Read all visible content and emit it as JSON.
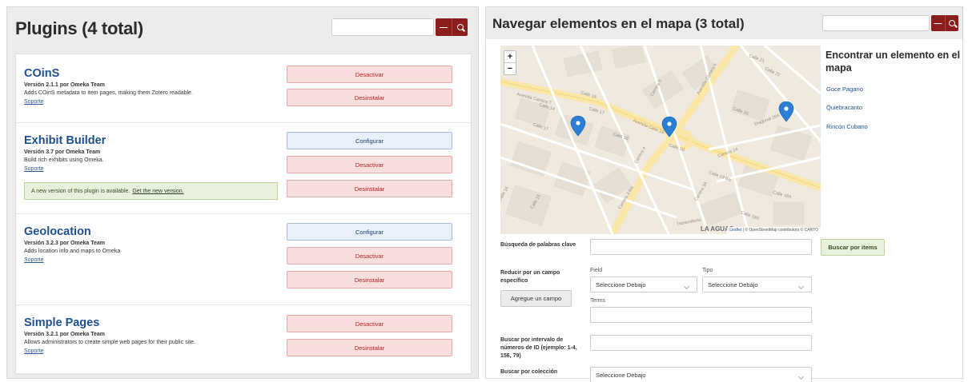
{
  "left": {
    "title": "Plugins (4 total)",
    "search_minus": "—",
    "plugins": [
      {
        "name": "COinS",
        "version": "Versión 2.1.1 por Omeka Team",
        "description": "Adds COinS metadata to item pages, making them Zotero readable.",
        "support": "Soporte",
        "buttons": [
          "Desactivar",
          "Desinstalar"
        ]
      },
      {
        "name": "Exhibit Builder",
        "version": "Versión 3.7 por Omeka Team",
        "description": "Build rich exhibits using Omeka.",
        "support": "Soporte",
        "buttons": [
          "Configurar",
          "Desactivar",
          "Desinstalar"
        ],
        "notice": "A new version of this plugin is available.",
        "notice_link": "Get the new version."
      },
      {
        "name": "Geolocation",
        "version": "Versión 3.2.3 por Omeka Team",
        "description": "Adds location info and maps to Omeka",
        "support": "Soporte",
        "buttons": [
          "Configurar",
          "Desactivar",
          "Desinstalar"
        ]
      },
      {
        "name": "Simple Pages",
        "version": "Versión 3.2.1 por Omeka Team",
        "description": "Allows administrators to create simple web pages for their public site.",
        "support": "Soporte",
        "buttons": [
          "Desactivar",
          "Desinstalar"
        ]
      }
    ]
  },
  "right": {
    "title": "Navegar elementos en el mapa (3 total)",
    "search_minus": "—",
    "map": {
      "zoom_in": "+",
      "zoom_out": "−",
      "attribution_leaflet": "Leaflet",
      "attribution_rest": "| © OpenStreetMap contributors © CARTO",
      "street_labels": [
        "Avenida Carrera 7",
        "Avenida Calle 19",
        "Carrera 4",
        "Carrera 5",
        "Calle 20",
        "Calle 21",
        "Calle 22",
        "Calle 18",
        "Calle 17",
        "Calle 16",
        "Calle 14",
        "Diagonal 20A",
        "Carrera 2A",
        "Calle 19 Bis",
        "Carrera 3A",
        "Carrera 3 Bis",
        "Calle 18A",
        "Calle 15",
        "LA AGUAS",
        "Transmilenio"
      ]
    },
    "find": {
      "title": "Encontrar un elemento en el mapa",
      "items": [
        "Goce Pagano",
        "Quiebracanto",
        "Rincón Cubano"
      ]
    },
    "form": {
      "keyword_label": "Búsqueda de palabras clave",
      "search_button": "Buscar por items",
      "narrow_label": "Reducir por un campo específico",
      "field_label": "Field",
      "type_label": "Tipo",
      "field_select": "Seleccione Debajo",
      "type_select": "Seleccione Debajo",
      "add_field_button": "Agregue un campo",
      "terms_label": "Terms",
      "id_range_label": "Buscar por intervalo de números de ID (ejemplo: 1-4, 156, 79)",
      "collection_label": "Buscar por colección",
      "collection_select": "Seleccione Debajo"
    }
  },
  "colors": {
    "brand_red": "#8b1d1d",
    "link_blue": "#1f4f8f",
    "danger_bg": "#f9dede",
    "info_bg": "#e8f0f9",
    "success_bg": "#e8f1dc",
    "marker_blue": "#2a7fd4"
  }
}
